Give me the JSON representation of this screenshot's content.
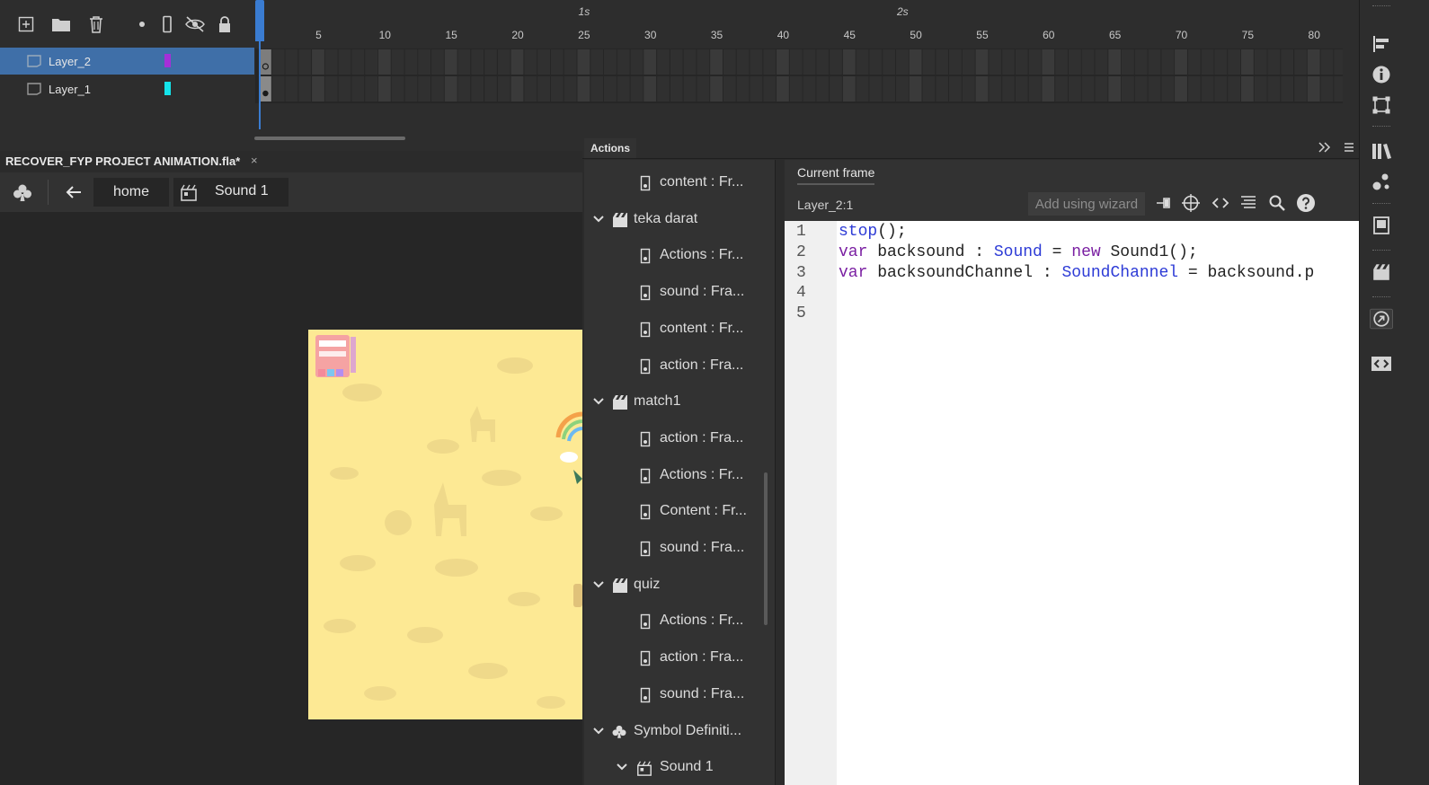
{
  "timeline": {
    "toolbar_icons": [
      "new-layer-icon",
      "new-folder-icon",
      "delete-icon",
      "dot-icon",
      "outline-icon",
      "hide-icon",
      "lock-icon"
    ],
    "layers": [
      {
        "name": "Layer_2",
        "color": "#a52fd8",
        "selected": true
      },
      {
        "name": "Layer_1",
        "color": "#14e3ea",
        "selected": false
      }
    ],
    "ruler": {
      "frame_ticks": [
        "5",
        "10",
        "15",
        "20",
        "25",
        "30",
        "35",
        "40",
        "45",
        "50",
        "55",
        "60",
        "65",
        "70",
        "75",
        "80"
      ],
      "seconds": [
        "1s",
        "2s"
      ]
    }
  },
  "document": {
    "tab_title": "RECOVER_FYP PROJECT ANIMATION.fla*",
    "close_glyph": "×",
    "breadcrumb": {
      "home": "home",
      "symbol": "Sound 1"
    }
  },
  "actions": {
    "tab_label": "Actions",
    "tree": [
      {
        "label": "content : Fr...",
        "type": "frame",
        "indent": 2
      },
      {
        "label": "teka darat",
        "type": "scene",
        "indent": 0
      },
      {
        "label": "Actions : Fr...",
        "type": "frame",
        "indent": 2
      },
      {
        "label": "sound : Fra...",
        "type": "frame",
        "indent": 2
      },
      {
        "label": "content : Fr...",
        "type": "frame",
        "indent": 2
      },
      {
        "label": "action : Fra...",
        "type": "frame",
        "indent": 2
      },
      {
        "label": "match1",
        "type": "scene",
        "indent": 0
      },
      {
        "label": "action : Fra...",
        "type": "frame",
        "indent": 2
      },
      {
        "label": "Actions : Fr...",
        "type": "frame",
        "indent": 2
      },
      {
        "label": "Content : Fr...",
        "type": "frame",
        "indent": 2
      },
      {
        "label": "sound : Fra...",
        "type": "frame",
        "indent": 2
      },
      {
        "label": "quiz",
        "type": "scene",
        "indent": 0
      },
      {
        "label": "Actions : Fr...",
        "type": "frame",
        "indent": 2
      },
      {
        "label": "action : Fra...",
        "type": "frame",
        "indent": 2
      },
      {
        "label": "sound : Fra...",
        "type": "frame",
        "indent": 2
      },
      {
        "label": "Symbol Definiti...",
        "type": "symbols",
        "indent": 0
      },
      {
        "label": "Sound 1",
        "type": "movieclip",
        "indent": 1
      }
    ],
    "current_frame_tab": "Current frame",
    "layer_ref": "Layer_2:1",
    "wizard_placeholder": "Add using wizard",
    "toolbar_icons": [
      "pin-icon",
      "target-icon",
      "code-snippet-icon",
      "format-icon",
      "search-icon",
      "help-icon"
    ],
    "code": {
      "line_numbers": [
        "1",
        "2",
        "3",
        "4",
        "5"
      ],
      "lines": [
        [
          {
            "t": "stop",
            "c": "fn"
          },
          {
            "t": "();",
            "c": ""
          }
        ],
        [
          {
            "t": "var",
            "c": "kw"
          },
          {
            "t": " backsound : ",
            "c": ""
          },
          {
            "t": "Sound",
            "c": "ty"
          },
          {
            "t": " = ",
            "c": ""
          },
          {
            "t": "new",
            "c": "kw"
          },
          {
            "t": " Sound1();",
            "c": ""
          }
        ],
        [
          {
            "t": "var",
            "c": "kw"
          },
          {
            "t": " backsoundChannel : ",
            "c": ""
          },
          {
            "t": "SoundChannel",
            "c": "ty"
          },
          {
            "t": " = backsound.p",
            "c": ""
          }
        ],
        [],
        []
      ]
    }
  },
  "dock": {
    "icons": [
      "align-icon",
      "info-icon",
      "transform-icon",
      "library-icon",
      "components-icon",
      "frame-picker-icon",
      "scene-icon",
      "motion-presets-icon",
      "code-snippets-icon"
    ]
  }
}
